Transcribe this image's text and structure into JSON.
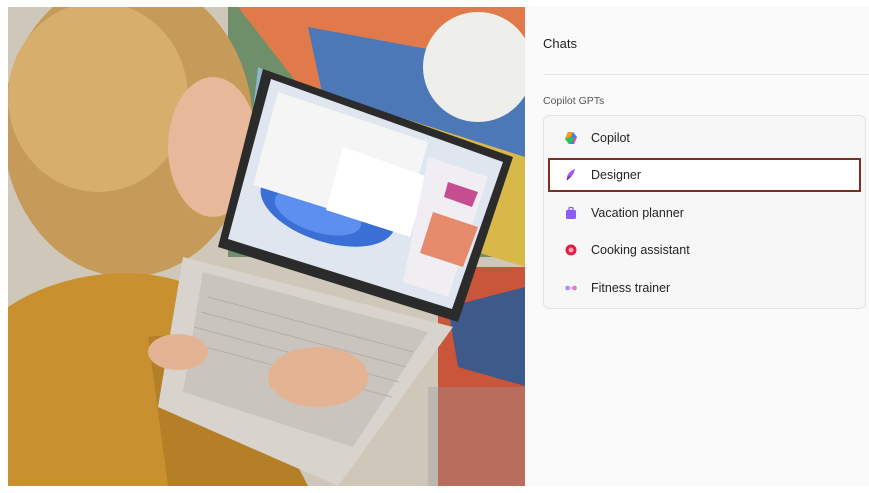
{
  "panel": {
    "title": "Chats",
    "section_label": "Copilot GPTs",
    "items": [
      {
        "label": "Copilot",
        "icon": "copilot-icon",
        "selected": false
      },
      {
        "label": "Designer",
        "icon": "designer-icon",
        "selected": true
      },
      {
        "label": "Vacation planner",
        "icon": "vacation-planner-icon",
        "selected": false
      },
      {
        "label": "Cooking assistant",
        "icon": "cooking-assistant-icon",
        "selected": false
      },
      {
        "label": "Fitness trainer",
        "icon": "fitness-trainer-icon",
        "selected": false
      }
    ],
    "highlight_color": "#7a2f22"
  }
}
